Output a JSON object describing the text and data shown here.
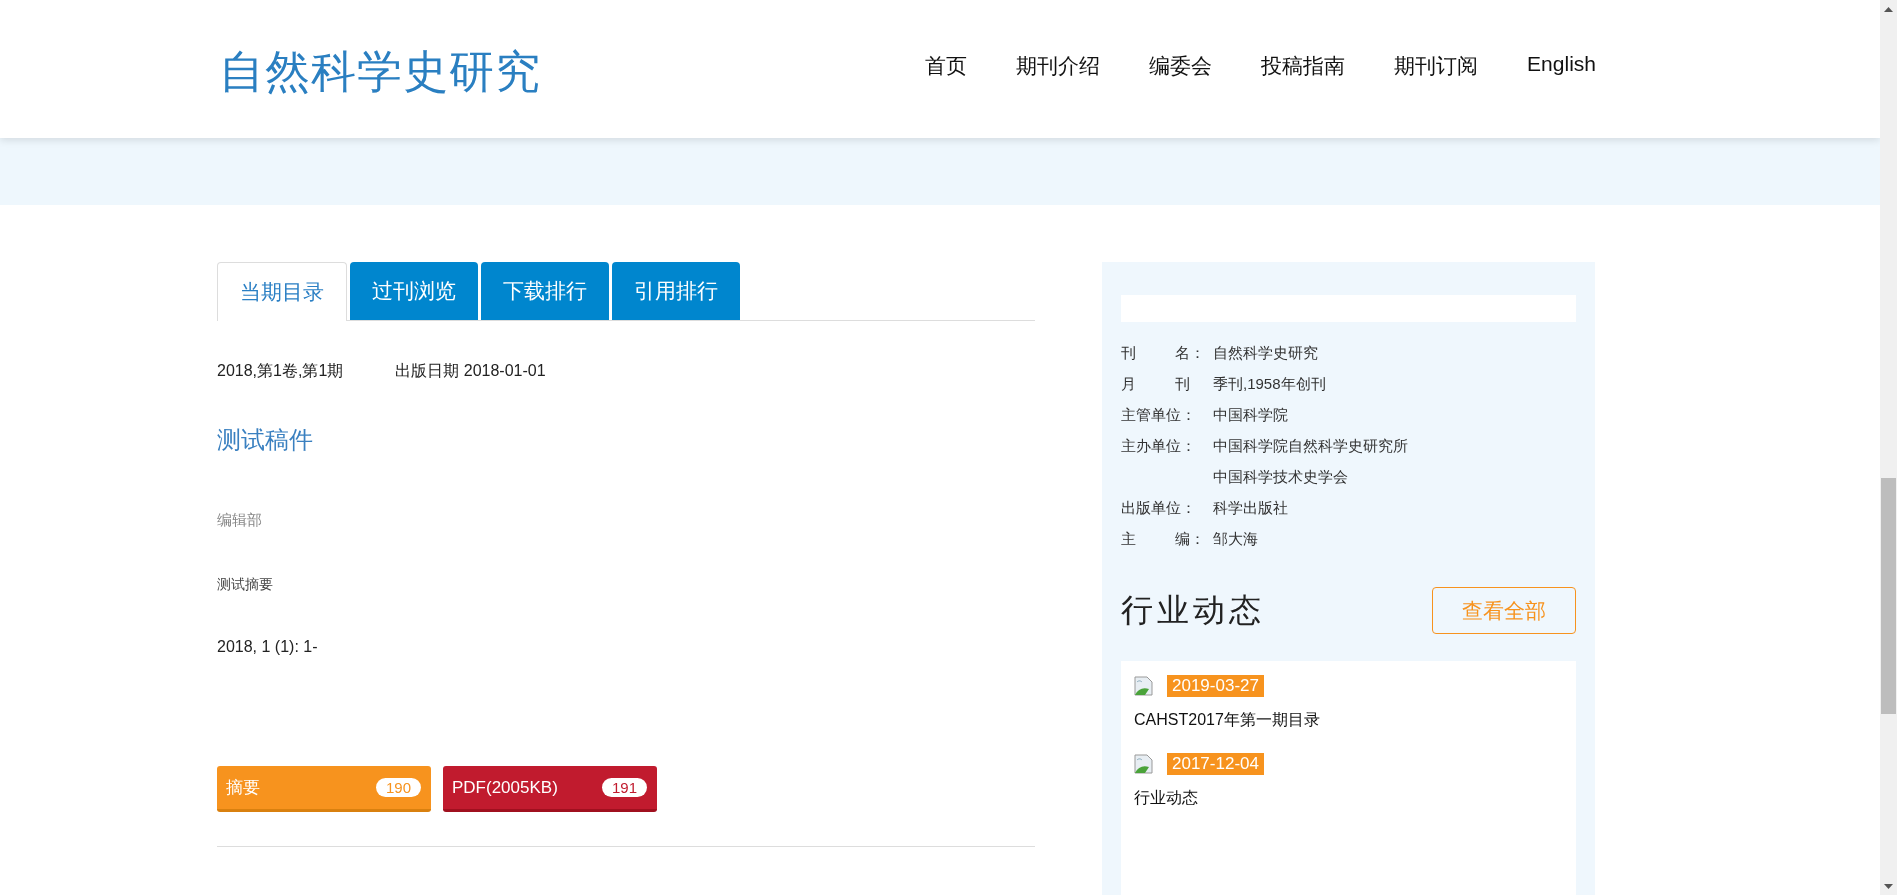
{
  "header": {
    "logo": "自然科学史研究",
    "nav": [
      {
        "label": "首页"
      },
      {
        "label": "期刊介绍"
      },
      {
        "label": "编委会"
      },
      {
        "label": "投稿指南"
      },
      {
        "label": "期刊订阅"
      },
      {
        "label": "English"
      }
    ]
  },
  "tabs": [
    {
      "label": "当期目录",
      "selected": true
    },
    {
      "label": "过刊浏览",
      "selected": false
    },
    {
      "label": "下载排行",
      "selected": false
    },
    {
      "label": "引用排行",
      "selected": false
    }
  ],
  "issue": {
    "volume": "2018,第1卷,第1期",
    "published": "出版日期 2018-01-01"
  },
  "article": {
    "title": "测试稿件",
    "authors": "编辑部",
    "abstract": "测试摘要",
    "citation": "2018, 1 (1): 1-",
    "buttons": [
      {
        "kind": "abstract",
        "label": "摘要",
        "count": "190"
      },
      {
        "kind": "pdf",
        "label": "PDF(2005KB)",
        "count": "191"
      }
    ]
  },
  "journal_info": [
    {
      "label": "刊 名：",
      "values": [
        "自然科学史研究"
      ]
    },
    {
      "label": "月 刊",
      "values": [
        "季刊,1958年创刊"
      ]
    },
    {
      "label": "主管单位：",
      "values": [
        "中国科学院"
      ]
    },
    {
      "label": "主办单位：",
      "values": [
        "中国科学院自然科学史研究所",
        "中国科学技术史学会"
      ]
    },
    {
      "label": "出版单位：",
      "values": [
        "科学出版社"
      ]
    },
    {
      "label": "主 编：",
      "values": [
        "邹大海"
      ]
    }
  ],
  "news": {
    "heading": "行业动态",
    "more_button": "查看全部",
    "items": [
      {
        "date": "2019-03-27",
        "title": "CAHST2017年第一期目录"
      },
      {
        "date": "2017-12-04",
        "title": "行业动态"
      }
    ]
  }
}
